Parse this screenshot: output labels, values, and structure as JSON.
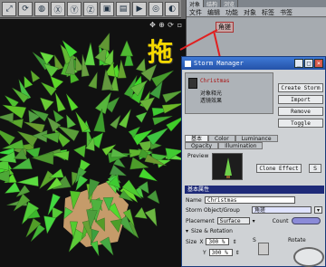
{
  "toolbar": {
    "buttons": [
      "scale",
      "rotate",
      "world",
      "x",
      "y",
      "z",
      "render-region",
      "render-view",
      "render",
      "camera",
      "display",
      "object",
      "deform",
      "light"
    ]
  },
  "object_manager": {
    "tabs": [
      "对象",
      "结构",
      "浏览"
    ],
    "menu": [
      "文件",
      "编辑",
      "功能",
      "对象",
      "标签",
      "书签"
    ],
    "dragged_item": "角搓"
  },
  "annotation": {
    "drag_text": "拖",
    "drag_color": "#f5d800"
  },
  "dialog": {
    "title": "Storm Manager",
    "object": {
      "name": "Christmas",
      "line1": "对象释光",
      "line2": "透镜效果"
    },
    "buttons": {
      "create": "Create Storm",
      "import": "Import",
      "remove": "Remove",
      "toggle": "Toggle"
    },
    "tabs_row1": [
      "基本",
      "Color",
      "Luminance"
    ],
    "tabs_row2": [
      "Opacity",
      "Illumination"
    ],
    "preview_label": "Preview",
    "clone_effect": "Clone Effect",
    "s_button": "S",
    "section_title": "基本属性",
    "name_label": "Name",
    "name_value": "Christmas",
    "storm_label": "Storm Object/Group",
    "storm_value": "角搓",
    "placement_label": "Placement",
    "placement_value": "Surface",
    "count_label": "Count",
    "size_rot_label": "Size & Rotation",
    "size_label": "Size",
    "size_x_label": "X",
    "size_x": "300 %",
    "size_y_label": "Y",
    "size_y": "300 %",
    "s_label": "S",
    "rotate_label": "Rotate"
  }
}
